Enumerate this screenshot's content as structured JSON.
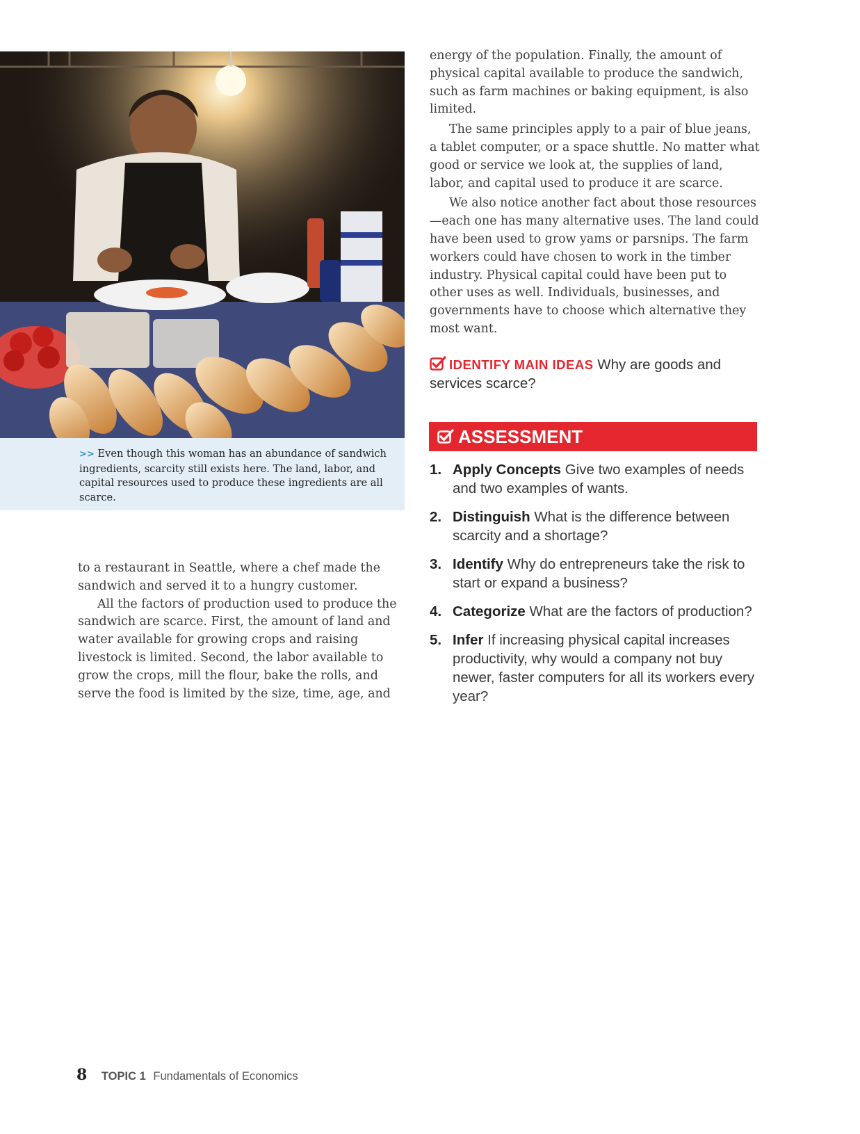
{
  "photo": {
    "caption_marker": ">>",
    "caption": "Even though this woman has an abundance of sandwich ingredients, scarcity still exists here. The land, labor, and capital resources used to produce these ingredients are all scarce."
  },
  "left_column": {
    "p1": "to a restaurant in Seattle, where a chef made the sandwich and served it to a hungry customer.",
    "p2": "All the factors of production used to produce the sandwich are scarce. First, the amount of land and water available for growing crops and raising livestock is limited. Second, the labor available to grow the crops, mill the flour, bake the rolls, and serve the food is limited by the size, time, age, and"
  },
  "right_column": {
    "p1": "energy of the population. Finally, the amount of physical capital available to produce the sandwich, such as farm machines or baking equipment, is also limited.",
    "p2": "The same principles apply to a pair of blue jeans, a tablet computer, or a space shuttle. No matter what good or service we look at, the supplies of land, labor, and capital used to produce it are scarce.",
    "p3": "We also notice another fact about those resources —each one has many alternative uses. The land could have been used to grow yams or parsnips. The farm workers could have chosen to work in the timber industry. Physical capital could have been put to other uses as well. Individuals, businesses, and governments have to choose which alternative they most want."
  },
  "identify": {
    "tag": "IDENTIFY MAIN IDEAS",
    "question": "Why are goods and services scarce?"
  },
  "assessment": {
    "title": "ASSESSMENT",
    "items": [
      {
        "num": "1.",
        "key": "Apply Concepts",
        "text": "Give two examples of needs and two examples of wants."
      },
      {
        "num": "2.",
        "key": "Distinguish",
        "text": "What is the difference between scarcity and a shortage?"
      },
      {
        "num": "3.",
        "key": "Identify",
        "text": "Why do entrepreneurs take the risk to start or expand a business?"
      },
      {
        "num": "4.",
        "key": "Categorize",
        "text": "What are the factors of production?"
      },
      {
        "num": "5.",
        "key": "Infer",
        "text": "If increasing physical capital increases productivity, why would a company not buy newer, faster computers for all its workers every year?"
      }
    ]
  },
  "footer": {
    "page_number": "8",
    "topic_label": "TOPIC 1",
    "topic_title": "Fundamentals of Economics"
  },
  "colors": {
    "accent_red": "#e4262f",
    "caption_bg": "#e3eef7",
    "caption_marker": "#2a8fc9"
  }
}
